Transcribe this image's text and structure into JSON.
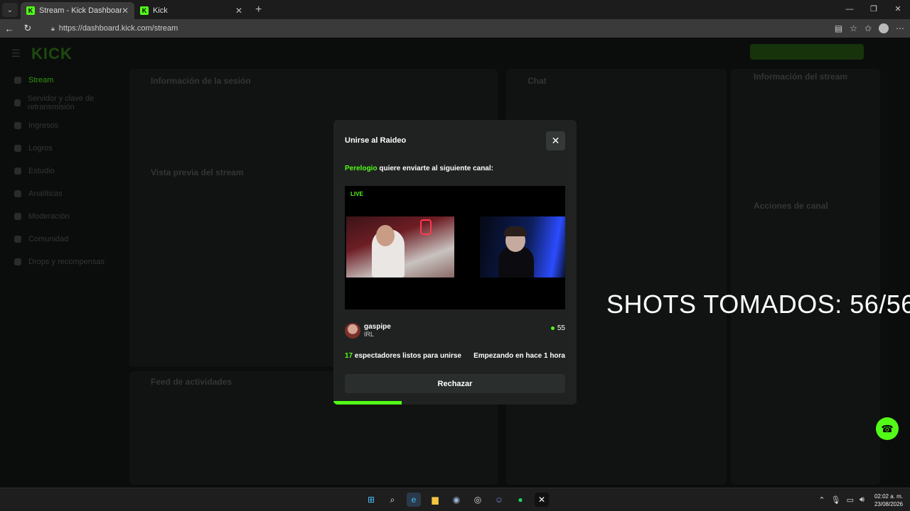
{
  "browser": {
    "tabs": [
      {
        "title": "Stream - Kick Dashboard",
        "favicon": "K",
        "active": true
      },
      {
        "title": "Kick",
        "favicon": "K",
        "active": false
      }
    ],
    "new_tab": "+",
    "url": "https://dashboard.kick.com/stream"
  },
  "dashboard": {
    "logo": "KICK",
    "sidebar": [
      "Stream",
      "Servidor y clave de retransmisión",
      "Ingresos",
      "Logros",
      "Estudio",
      "Analíticas",
      "Moderación",
      "Comunidad",
      "Drops y recompensas"
    ],
    "panels": {
      "session_info": "Información de la sesión",
      "preview": "Vista previa del stream",
      "activity": "Feed de actividades",
      "chat": "Chat",
      "stream_info": "Información del stream",
      "channel_actions": "Acciones de canal"
    },
    "overlay_text": "SHOTS TOMADOS: 56/56"
  },
  "modal": {
    "title": "Unirse al Raideo",
    "close_icon": "close-icon",
    "sender": "Perelogio",
    "subtitle": " quiere enviarte al siguiente canal:",
    "live_label": "LIVE",
    "streamer_name": "gaspipe",
    "category": "IRL",
    "viewers": "55",
    "ready_count": "17",
    "ready_text": " espectadores listos para unirse",
    "starting_text": "Empezando en hace 1 hora",
    "reject_label": "Rechazar",
    "progress_fraction": 0.28,
    "accent_color": "#53fc18"
  },
  "taskbar": {
    "time": "02:02 a. m.",
    "date": "23/08/2026"
  }
}
